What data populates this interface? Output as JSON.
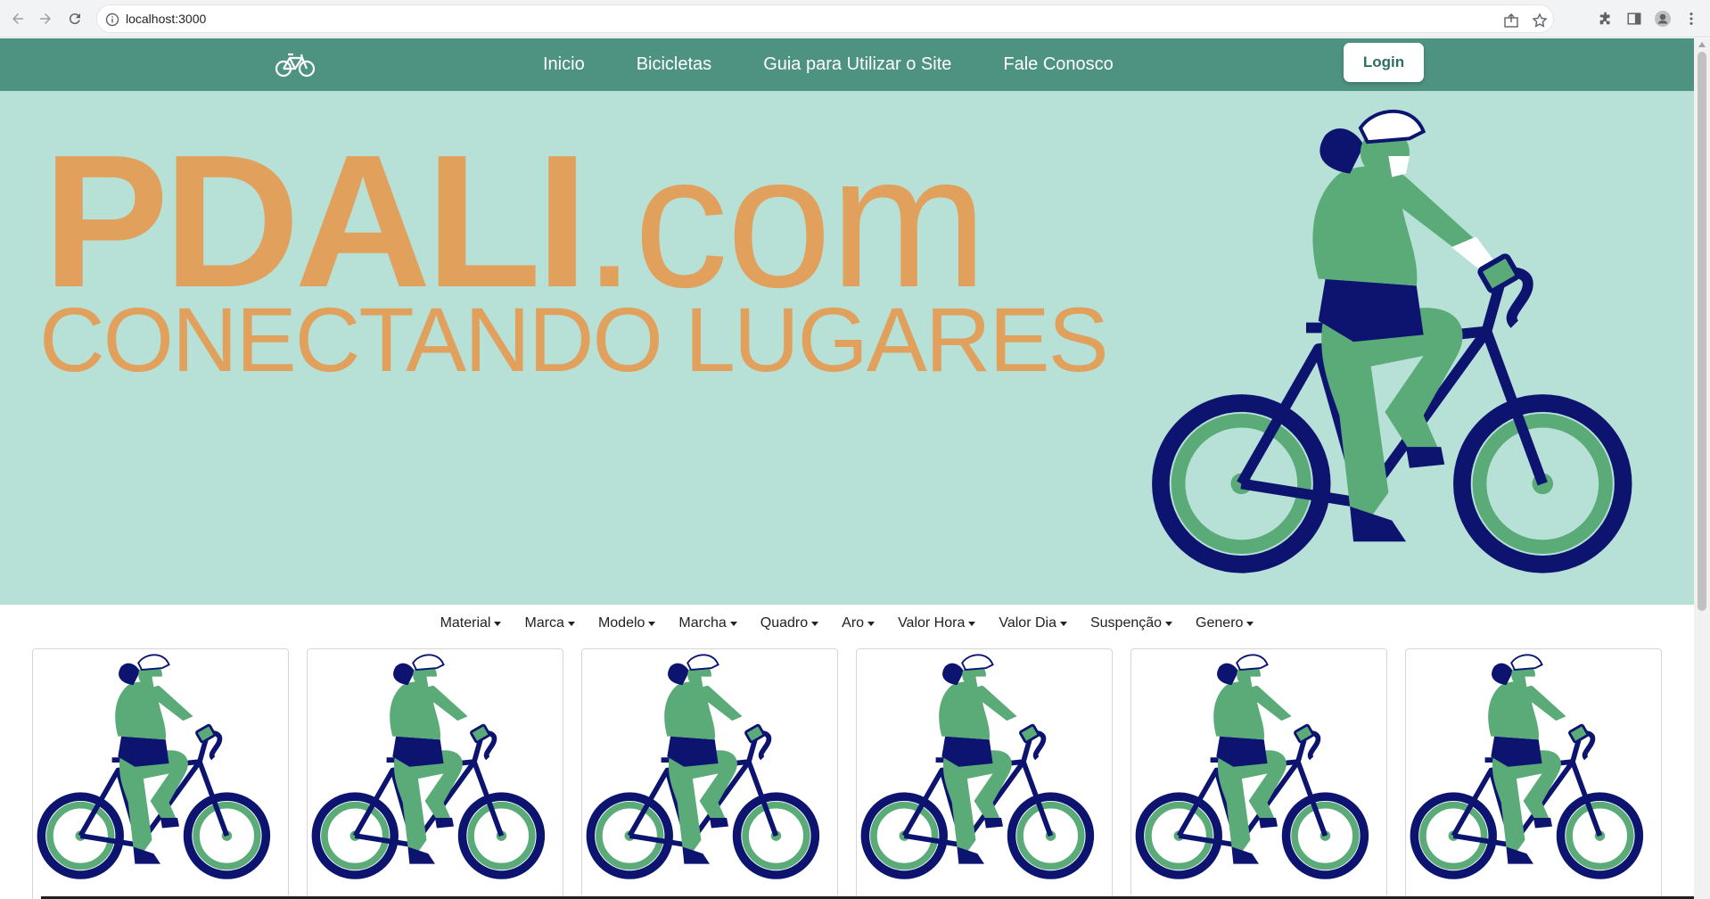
{
  "browser": {
    "url": "localhost:3000",
    "icons": [
      "back-icon",
      "forward-icon",
      "reload-icon",
      "info-icon",
      "share-icon",
      "star-icon",
      "extensions-icon",
      "side-panel-icon",
      "profile-icon",
      "menu-icon"
    ]
  },
  "header": {
    "brand_icon": "bicycle-icon",
    "nav_items": [
      "Inicio",
      "Bicicletas",
      "Guia para Utilizar o Site",
      "Fale Conosco"
    ],
    "login_label": "Login",
    "colors": {
      "nav_bg": "#4e9281",
      "login_text": "#2f6f60"
    }
  },
  "hero": {
    "title_main": "PDALI",
    "title_suffix": ".com",
    "subtitle": "CONECTANDO LUGARES",
    "illustration": "cyclist-illustration",
    "colors": {
      "background": "#b7e0d7",
      "text": "#e1a05c",
      "bike_navy": "#0d1470",
      "bike_green": "#5aab78"
    }
  },
  "filters": [
    "Material",
    "Marca",
    "Modelo",
    "Marcha",
    "Quadro",
    "Aro",
    "Valor Hora",
    "Valor Dia",
    "Suspenção",
    "Genero"
  ],
  "cards": [
    {
      "image": "cyclist-illustration"
    },
    {
      "image": "cyclist-illustration"
    },
    {
      "image": "cyclist-illustration"
    },
    {
      "image": "cyclist-illustration"
    },
    {
      "image": "cyclist-illustration"
    },
    {
      "image": "cyclist-illustration"
    }
  ]
}
